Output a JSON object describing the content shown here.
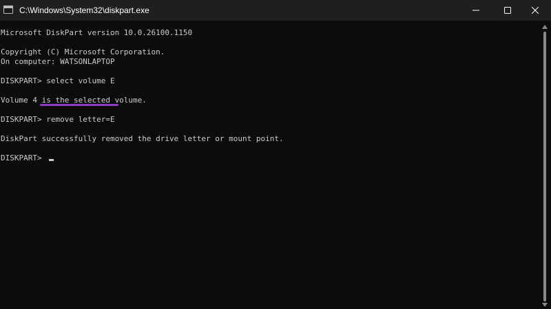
{
  "window": {
    "title": "C:\\Windows\\System32\\diskpart.exe",
    "icons": {
      "app": "console-app-icon",
      "minimize": "minimize-icon",
      "maximize": "maximize-icon",
      "close": "close-icon"
    }
  },
  "console": {
    "lines": [
      "Microsoft DiskPart version 10.0.26100.1150",
      "",
      "Copyright (C) Microsoft Corporation.",
      "On computer: WATSONLAPTOP",
      "",
      "DISKPART> select volume E",
      "",
      "Volume 4 is the selected volume.",
      "",
      "DISKPART> remove letter=E",
      "",
      "DiskPart successfully removed the drive letter or mount point.",
      "",
      "DISKPART> "
    ]
  },
  "colors": {
    "background": "#0c0c0c",
    "titlebar": "#1f1f1f",
    "text": "#cccccc",
    "highlight_underline": "#8f3bc4"
  }
}
